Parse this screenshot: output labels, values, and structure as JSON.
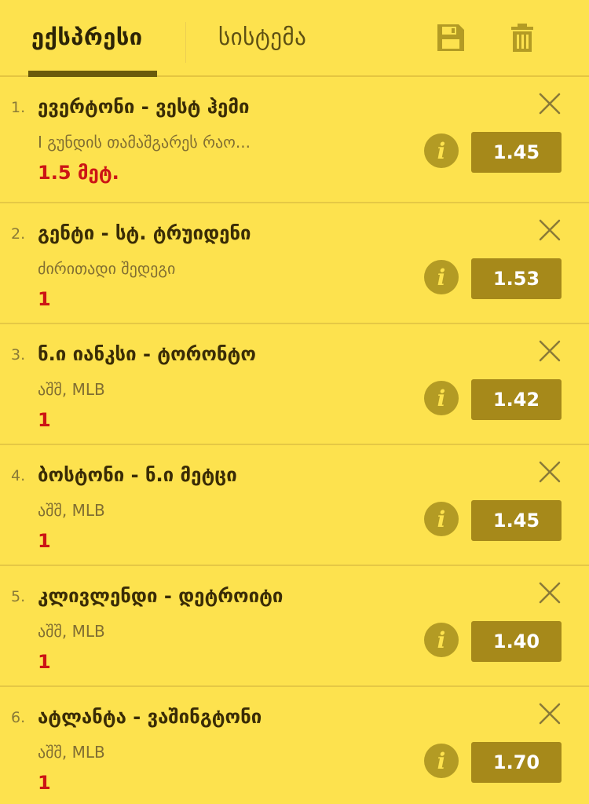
{
  "tabs": [
    {
      "label": "ექსპრესი"
    },
    {
      "label": "სისტემა"
    }
  ],
  "icons": {
    "save": "save-icon",
    "trash": "trash-icon",
    "close": "close-icon",
    "info": "info-icon"
  },
  "colors": {
    "background": "#fde24e",
    "accent": "#a6891a",
    "pick": "#cc1515"
  },
  "bets": [
    {
      "num": "1.",
      "match": "ევერტონი - ვესტ ჰემი",
      "market": "I გუნდის თამაშგარეს რაო...",
      "pick": "1.5 მეტ.",
      "odds": "1.45"
    },
    {
      "num": "2.",
      "match": "გენტი - სტ. ტრუიდენი",
      "market": "ძირითადი შედეგი",
      "pick": "1",
      "odds": "1.53"
    },
    {
      "num": "3.",
      "match": "ნ.ი იანკსი - ტორონტო",
      "market": "აშშ, MLB",
      "pick": "1",
      "odds": "1.42"
    },
    {
      "num": "4.",
      "match": "ბოსტონი - ნ.ი მეტცი",
      "market": "აშშ, MLB",
      "pick": "1",
      "odds": "1.45"
    },
    {
      "num": "5.",
      "match": "კლივლენდი - დეტროიტი",
      "market": "აშშ, MLB",
      "pick": "1",
      "odds": "1.40"
    },
    {
      "num": "6.",
      "match": "ატლანტა - ვაშინგტონი",
      "market": "აშშ, MLB",
      "pick": "1",
      "odds": "1.70"
    }
  ]
}
